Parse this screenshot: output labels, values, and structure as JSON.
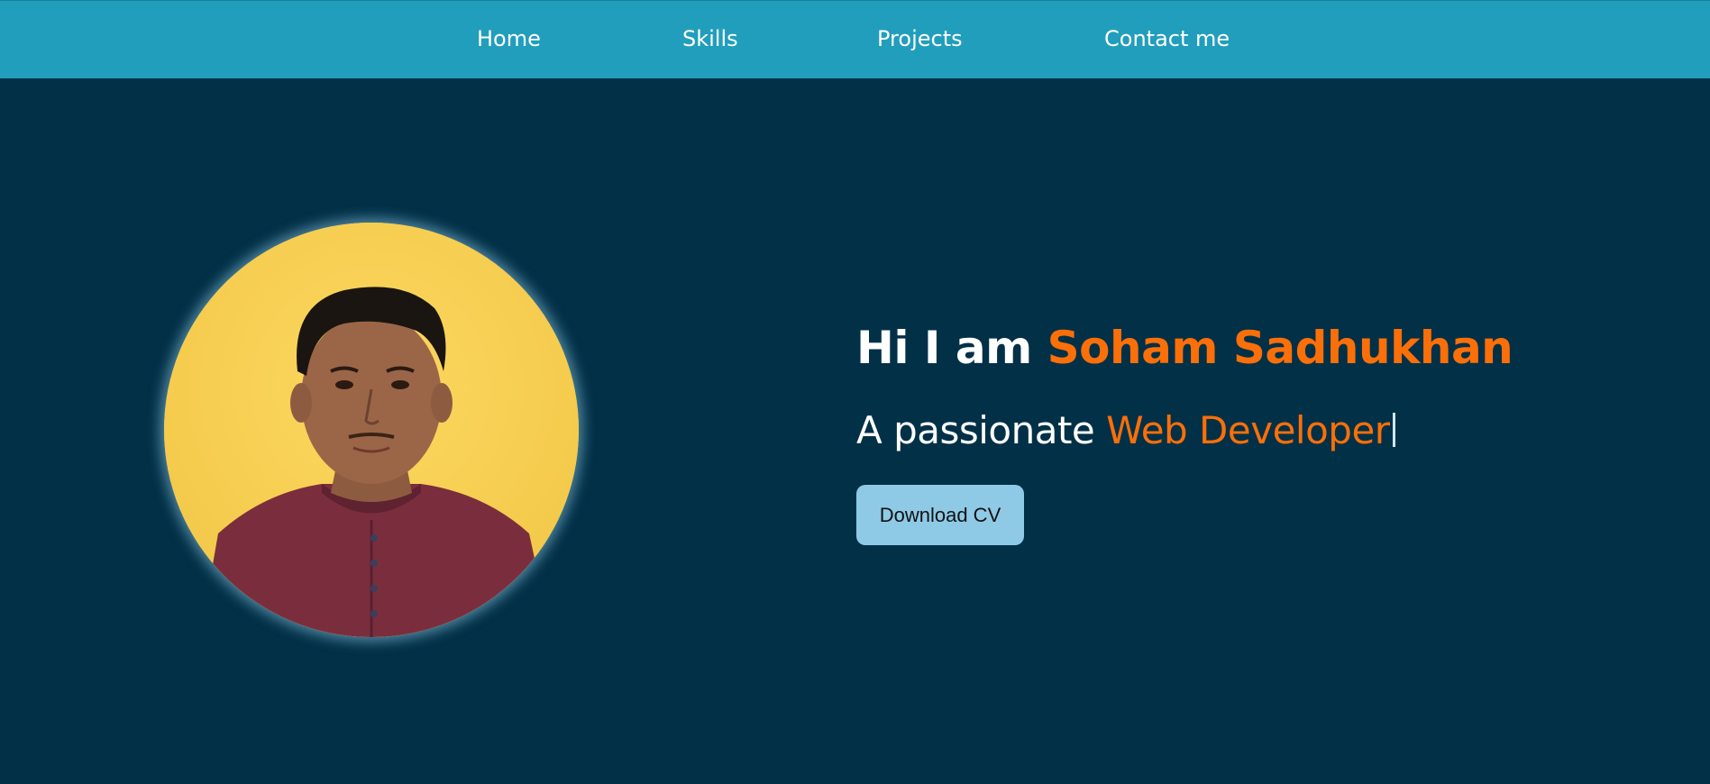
{
  "nav": {
    "items": [
      {
        "label": "Home"
      },
      {
        "label": "Skills"
      },
      {
        "label": "Projects"
      },
      {
        "label": "Contact me"
      }
    ]
  },
  "hero": {
    "greeting": "Hi I am ",
    "name": "Soham Sadhukhan",
    "tagline_prefix": "A passionate ",
    "tagline_role": "Web Developer",
    "cta_label": "Download CV"
  },
  "colors": {
    "navbar": "#219ebc",
    "background": "#023047",
    "accent": "#fb6f09",
    "button": "#8ecae6"
  }
}
